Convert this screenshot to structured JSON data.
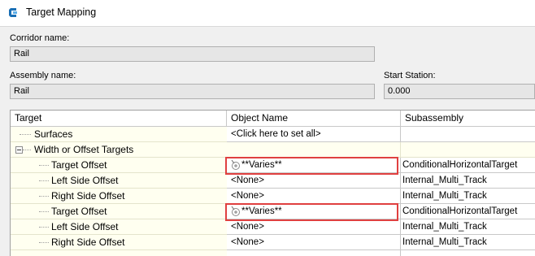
{
  "window": {
    "title": "Target Mapping"
  },
  "corridor": {
    "label": "Corridor name:",
    "value": "Rail"
  },
  "assembly": {
    "label": "Assembly name:",
    "value": "Rail"
  },
  "start_station": {
    "label": "Start Station:",
    "value": "0.000"
  },
  "grid": {
    "columns": [
      "Target",
      "Object Name",
      "Subassembly"
    ],
    "rows": [
      {
        "target": "Surfaces",
        "object": "<Click here to set all>",
        "subassembly": ""
      },
      {
        "target": "Width or Offset Targets",
        "object": "",
        "subassembly": ""
      },
      {
        "target": "Target Offset",
        "object": "**Varies**",
        "subassembly": "ConditionalHorizontalTarget"
      },
      {
        "target": "Left Side Offset",
        "object": "<None>",
        "subassembly": "Internal_Multi_Track"
      },
      {
        "target": "Right Side Offset",
        "object": "<None>",
        "subassembly": "Internal_Multi_Track"
      },
      {
        "target": "Target Offset",
        "object": "**Varies**",
        "subassembly": "ConditionalHorizontalTarget"
      },
      {
        "target": "Left Side Offset",
        "object": "<None>",
        "subassembly": "Internal_Multi_Track"
      },
      {
        "target": "Right Side Offset",
        "object": "<None>",
        "subassembly": "Internal_Multi_Track"
      }
    ]
  },
  "colors": {
    "highlight": "#e04040",
    "grid_background": "#fffff0",
    "titlebar": "#ffffff"
  },
  "icons": {
    "app": "civil3d-app-icon",
    "varies": "target-object-icon"
  }
}
